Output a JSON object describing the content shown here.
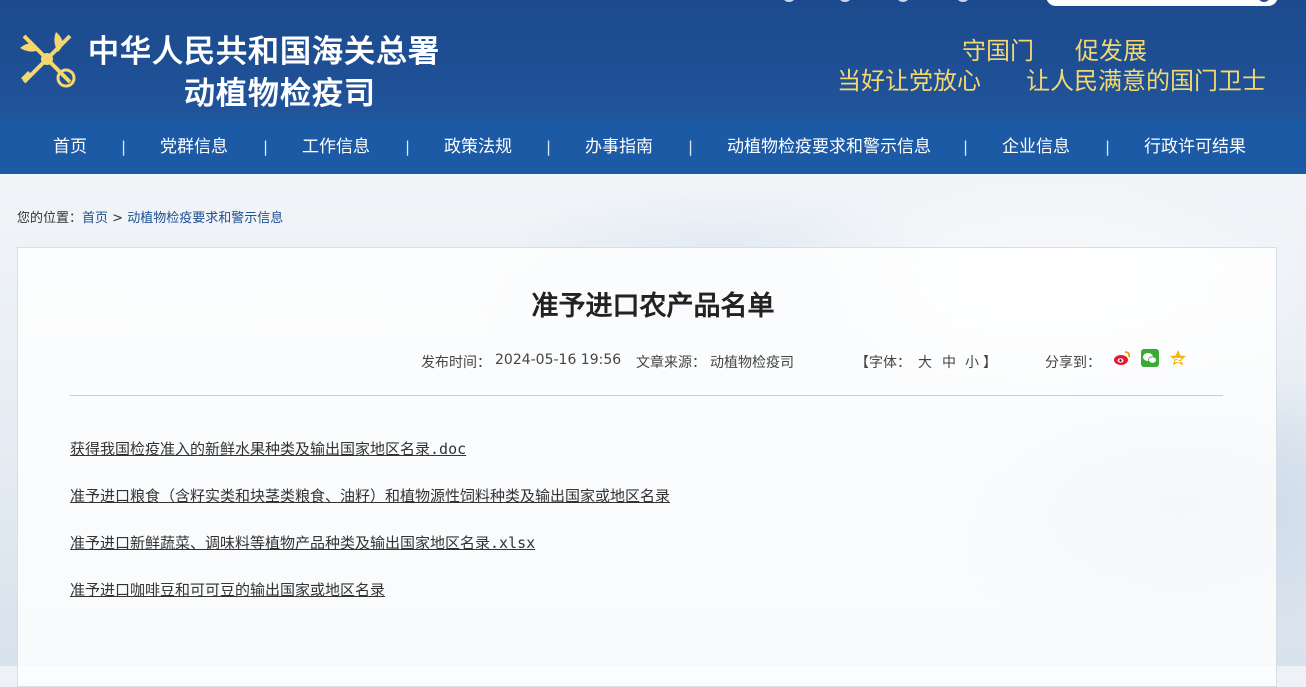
{
  "header": {
    "title_main": "中华人民共和国海关总署",
    "title_sub": "动植物检疫司",
    "slogans": [
      "守国门",
      "促发展",
      "当好让党放心",
      "让人民满意的国门卫士"
    ],
    "colors": {
      "header_bg": "#1f4f94",
      "nav_bg": "#1d5aa6",
      "slogan": "#f4d86f"
    }
  },
  "nav": {
    "items": [
      {
        "label": "首页"
      },
      {
        "label": "党群信息"
      },
      {
        "label": "工作信息"
      },
      {
        "label": "政策法规"
      },
      {
        "label": "办事指南"
      },
      {
        "label": "动植物检疫要求和警示信息"
      },
      {
        "label": "企业信息"
      },
      {
        "label": "行政许可结果"
      }
    ],
    "separator": "|"
  },
  "breadcrumb": {
    "prefix": "您的位置：",
    "home": "首页",
    "sep": " > ",
    "current": "动植物检疫要求和警示信息"
  },
  "article": {
    "title": "准予进口农产品名单",
    "publish_label": "发布时间：",
    "publish_time": "2024-05-16 19:56",
    "source_label": "文章来源：",
    "source": "动植物检疫司",
    "font_open": "【字体：",
    "font_large": "大",
    "font_medium": "中",
    "font_small": "小",
    "font_close": "】",
    "share_label": "分享到：",
    "share_icons": [
      "weibo-icon",
      "wechat-icon",
      "qzone-icon"
    ],
    "attachments": [
      {
        "label": "获得我国检疫准入的新鲜水果种类及输出国家地区名录.doc"
      },
      {
        "label": "准予进口粮食（含籽实类和块茎类粮食、油籽）和植物源性饲料种类及输出国家或地区名录"
      },
      {
        "label": "准予进口新鲜蔬菜、调味料等植物产品种类及输出国家地区名录.xlsx"
      },
      {
        "label": "准予进口咖啡豆和可可豆的输出国家或地区名录"
      }
    ]
  }
}
